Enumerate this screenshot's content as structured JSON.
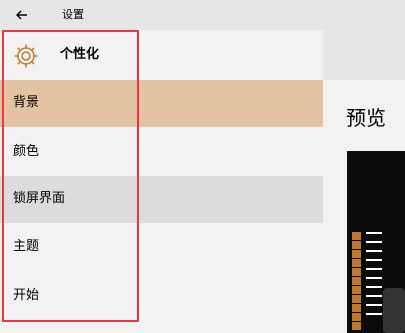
{
  "titlebar": {
    "title": "设置"
  },
  "sidebar": {
    "header_label": "个性化",
    "items": [
      {
        "label": "背景",
        "state": "selected"
      },
      {
        "label": "颜色",
        "state": "normal"
      },
      {
        "label": "锁屏界面",
        "state": "hover"
      },
      {
        "label": "主题",
        "state": "normal"
      },
      {
        "label": "开始",
        "state": "normal"
      }
    ]
  },
  "content": {
    "preview_title": "预览"
  },
  "colors": {
    "selected_bg": "#e3c3a1",
    "highlight_border": "#e8373f",
    "accent_tile": "#c2782c"
  },
  "icons": {
    "back": "back-arrow-icon",
    "header": "gear-icon"
  }
}
